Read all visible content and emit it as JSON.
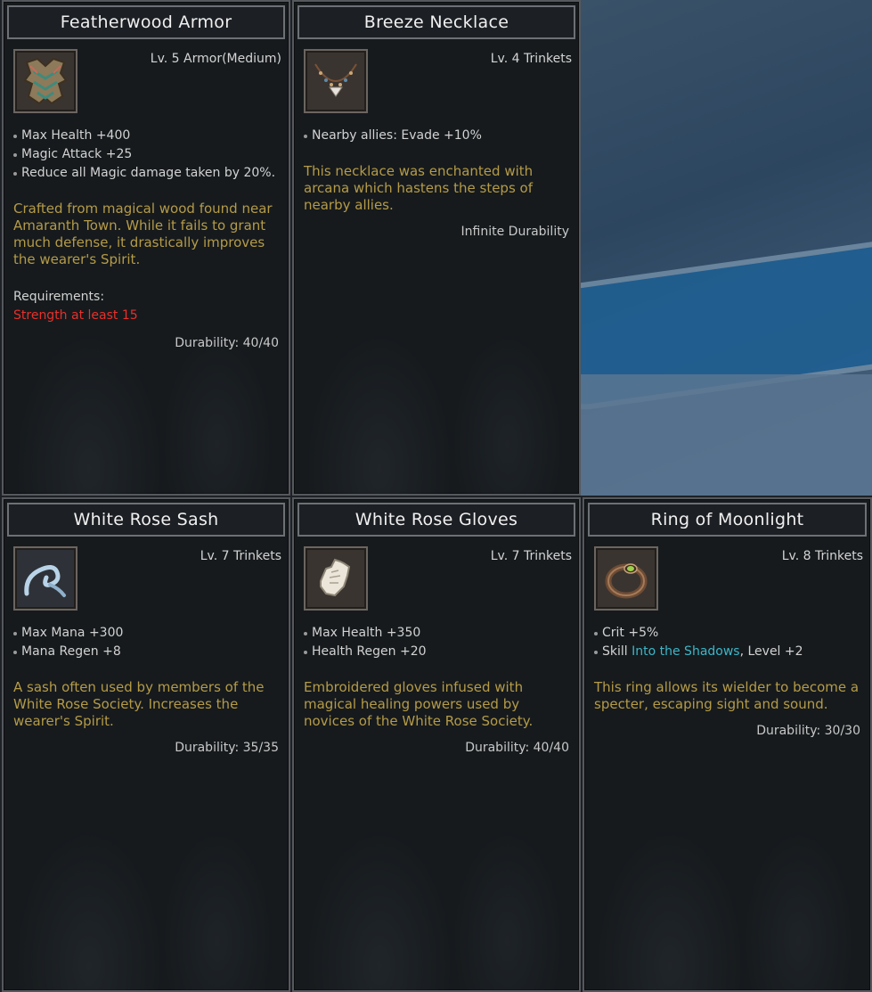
{
  "items": [
    {
      "name": "Featherwood Armor",
      "icon": "armor-icon",
      "level": "Lv. 5 Armor(Medium)",
      "stats": [
        "Max Health +400",
        "Magic Attack +25",
        "Reduce all Magic damage taken by 20%."
      ],
      "lore": "Crafted from magical wood found near Amaranth Town. While it fails to grant much defense, it drastically improves the wearer's Spirit.",
      "requirements_label": "Requirements:",
      "requirement": "Strength at least 15",
      "durability": "Durability: 40/40"
    },
    {
      "name": "Breeze Necklace",
      "icon": "necklace-icon",
      "level": "Lv. 4 Trinkets",
      "stats": [
        "Nearby allies: Evade +10%"
      ],
      "lore": "This necklace was enchanted with arcana which hastens the steps of nearby allies.",
      "durability": "Infinite Durability"
    },
    {
      "name": "White Rose Sash",
      "icon": "sash-icon",
      "level": "Lv. 7 Trinkets",
      "stats": [
        "Max Mana +300",
        "Mana Regen +8"
      ],
      "lore": "A sash often used by members of the White Rose Society. Increases the wearer's Spirit.",
      "durability": "Durability: 35/35"
    },
    {
      "name": "White Rose Gloves",
      "icon": "gloves-icon",
      "level": "Lv. 7 Trinkets",
      "stats": [
        "Max Health +350",
        "Health Regen +20"
      ],
      "lore": "Embroidered gloves infused with magical healing powers used by novices of the White Rose Society.",
      "durability": "Durability: 40/40"
    },
    {
      "name": "Ring of Moonlight",
      "icon": "ring-icon",
      "level": "Lv. 8 Trinkets",
      "stats": [
        "Crit +5%"
      ],
      "skill_prefix": "Skill ",
      "skill_name": "Into the Shadows",
      "skill_suffix": ", Level +2",
      "lore": "This ring allows its wielder to become a specter, escaping sight and sound.",
      "durability": "Durability: 30/30"
    }
  ],
  "colors": {
    "lore": "#b59b47",
    "requirement": "#e8302a",
    "skill": "#3cb6c8"
  }
}
